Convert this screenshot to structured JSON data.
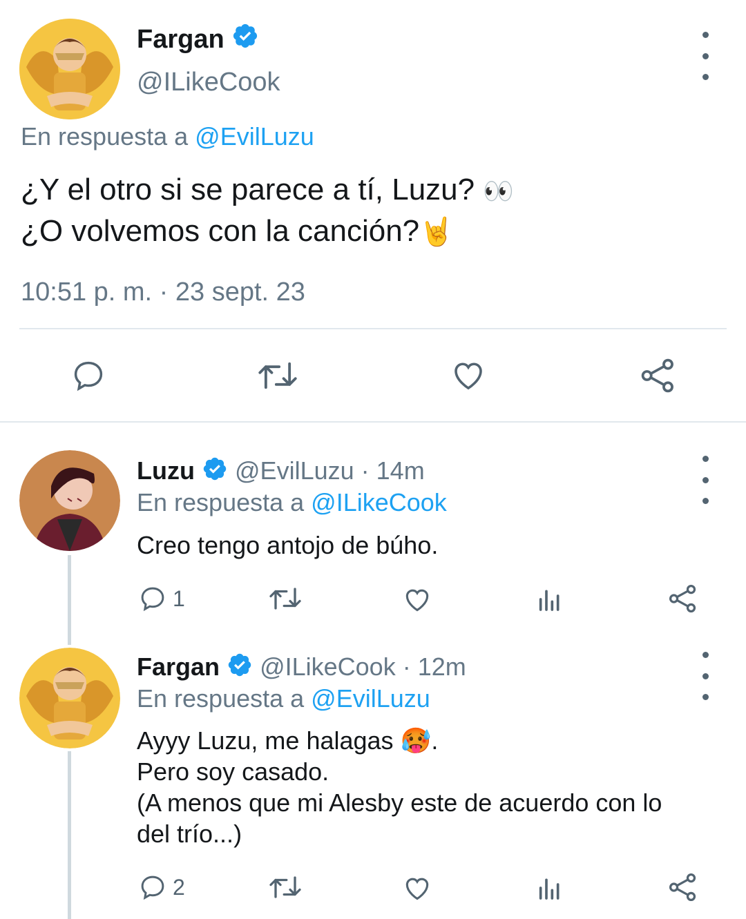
{
  "main_tweet": {
    "author": {
      "name": "Fargan",
      "handle": "@ILikeCook"
    },
    "reply_prefix": "En respuesta a",
    "reply_to": "@EvilLuzu",
    "text_line1": "¿Y el otro si se parece a tí, Luzu?",
    "text_line2": "¿O volvemos con la canción?",
    "emoji1": "👀",
    "emoji2": "🤘",
    "timestamp": "10:51 p. m. · 23 sept. 23"
  },
  "replies": [
    {
      "author": {
        "name": "Luzu",
        "handle": "@EvilLuzu",
        "time": "· 14m"
      },
      "reply_prefix": "En respuesta a",
      "reply_to": "@ILikeCook",
      "text": "Creo tengo antojo de búho.",
      "reply_count": "1"
    },
    {
      "author": {
        "name": "Fargan",
        "handle": "@ILikeCook",
        "time": "· 12m"
      },
      "reply_prefix": "En respuesta a",
      "reply_to": "@EvilLuzu",
      "text_line1": "Ayyy Luzu, me halagas",
      "emoji": "🥵",
      "text_line1_end": ".",
      "text_line2": "Pero soy casado.",
      "text_line3": "(A menos que mi Alesby este de acuerdo con lo",
      "text_line4": "del trío...)",
      "reply_count": "2"
    }
  ],
  "icons": {
    "reply": "reply-icon",
    "retweet": "retweet-icon",
    "like": "heart-icon",
    "share": "share-icon",
    "views": "views-icon",
    "verified": "verified-badge-icon",
    "more": "more-icon"
  },
  "colors": {
    "link": "#1da1f2",
    "muted": "#657786",
    "verified": "#1d9bf0",
    "avatar_fargan_bg": "#f5c542",
    "avatar_luzu_bg": "#c9874e"
  }
}
